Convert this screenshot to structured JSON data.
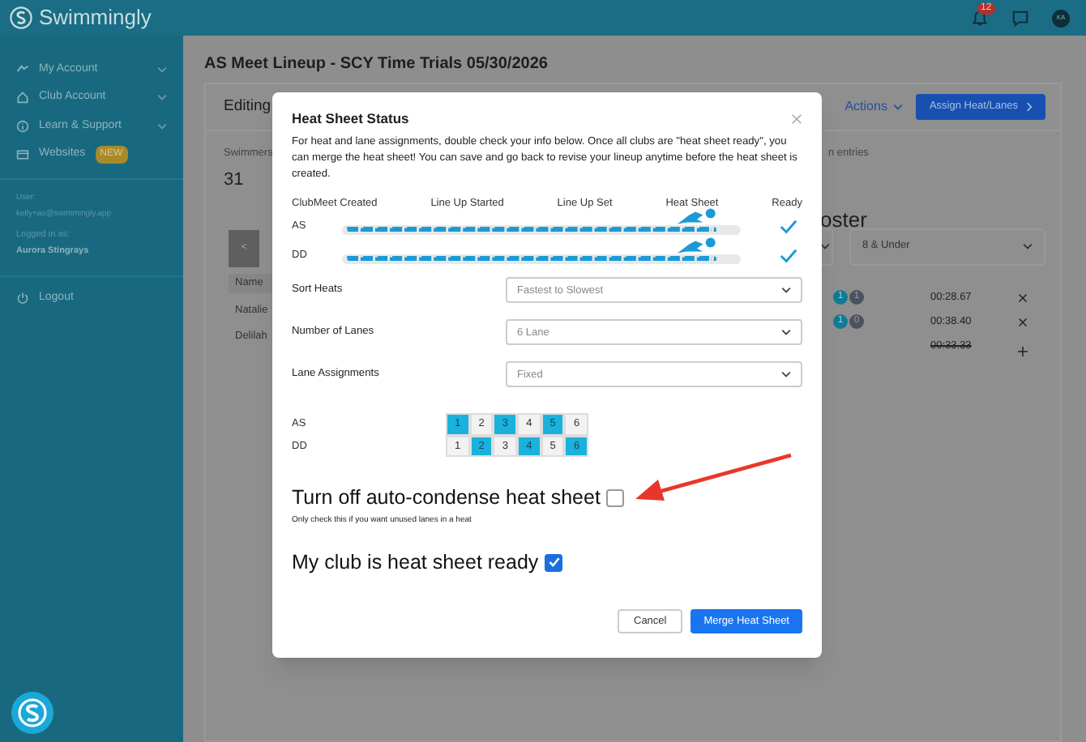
{
  "app": {
    "logo": "Swimmingly"
  },
  "topbar": {
    "notifications": "12",
    "avatar": "KA"
  },
  "sidebar": {
    "items": [
      {
        "kind": "account",
        "label": "My Account",
        "expandable": true
      },
      {
        "kind": "home",
        "label": "Club Account",
        "expandable": true
      },
      {
        "kind": "info",
        "label": "Learn & Support",
        "expandable": true
      },
      {
        "kind": "web",
        "label": "Websites",
        "badge": "NEW",
        "expandable": false
      }
    ],
    "user_label": "User:",
    "user_email": "kelly+as@swimmingly.app",
    "logged_label": "Logged in as:",
    "club": "Aurora Stingrays",
    "logout": "Logout"
  },
  "page": {
    "title": "AS Meet Lineup - SCY Time Trials 05/30/2026",
    "card_title": "Editing",
    "actions": "Actions",
    "assign_button": "Assign Heat/Lanes",
    "swimmers_label": "Swimmers",
    "swimmers_count": "31",
    "prev_button": "<",
    "name_header": "Name",
    "names": [
      "Natalie",
      "Delilah"
    ],
    "entries_text": "n entries",
    "roster_title": "oster",
    "roster_filter": "8 & Under",
    "entries": [
      {
        "kind": "remove",
        "badges": [
          "1",
          "1"
        ],
        "time": "00:28.67",
        "struck": false
      },
      {
        "kind": "remove",
        "badges": [
          "1",
          "0"
        ],
        "time": "00:38.40",
        "struck": false
      },
      {
        "kind": "add",
        "time": "00:33.33",
        "struck": true
      }
    ]
  },
  "modal": {
    "title": "Heat Sheet Status",
    "intro": "For heat and lane assignments, double check your info below. Once all clubs are \"heat sheet ready\", you can merge the heat sheet! You can save and go back to revise your lineup anytime before the heat sheet is created.",
    "stages": [
      "ClubMeet Created",
      "Line Up Started",
      "Line Up Set",
      "Heat Sheet",
      "Ready"
    ],
    "clubs": [
      {
        "name": "AS",
        "level": 0.93,
        "ready": true
      },
      {
        "name": "DD",
        "level": 0.93,
        "ready": true
      }
    ],
    "fields": [
      {
        "label": "Sort Heats",
        "value": "Fastest to Slowest"
      },
      {
        "label": "Number of Lanes",
        "value": "6 Lane"
      },
      {
        "label": "Lane Assignments",
        "value": "Fixed"
      }
    ],
    "lanes": [
      {
        "club": "AS",
        "lanes": [
          {
            "number": "1",
            "selected": true
          },
          {
            "number": "2",
            "selected": false
          },
          {
            "number": "3",
            "selected": true
          },
          {
            "number": "4",
            "selected": false
          },
          {
            "number": "5",
            "selected": true
          },
          {
            "number": "6",
            "selected": false
          }
        ]
      },
      {
        "club": "DD",
        "lanes": [
          {
            "number": "1",
            "selected": false
          },
          {
            "number": "2",
            "selected": true
          },
          {
            "number": "3",
            "selected": false
          },
          {
            "number": "4",
            "selected": true
          },
          {
            "number": "5",
            "selected": false
          },
          {
            "number": "6",
            "selected": true
          }
        ]
      }
    ],
    "options": [
      {
        "label": "Turn off auto-condense heat sheet",
        "hint": "Only check this if you want unused lanes in a heat",
        "checked": false
      },
      {
        "label": "My club is heat sheet ready",
        "checked": true
      }
    ],
    "annotation": {
      "kind": "arrow"
    },
    "cancel_button": "Cancel",
    "merge_button": "Merge Heat Sheet"
  }
}
